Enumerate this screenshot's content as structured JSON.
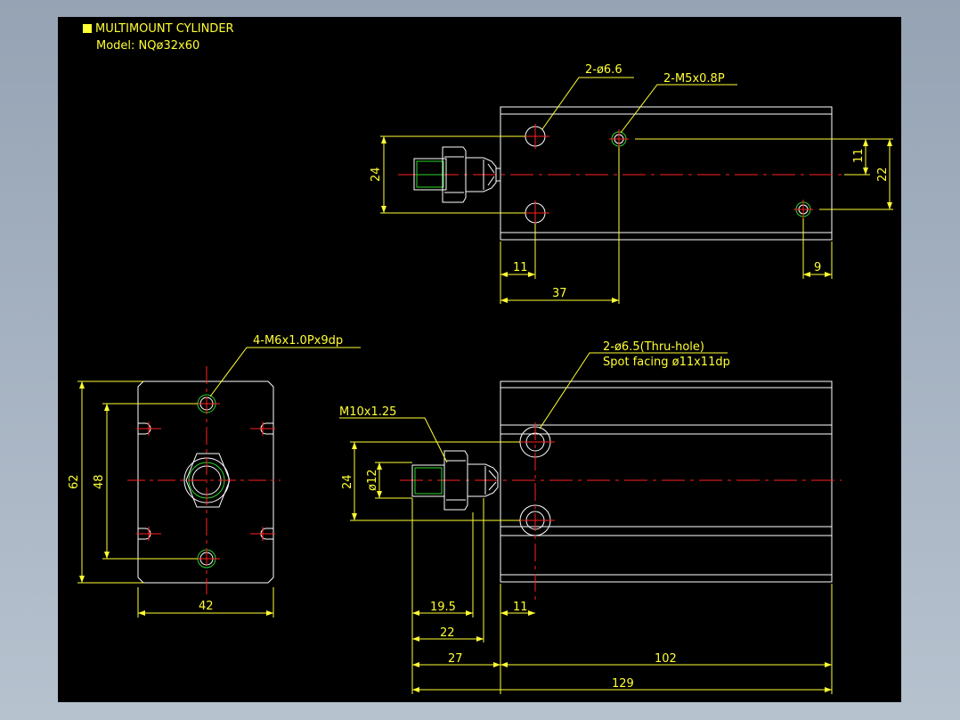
{
  "title": {
    "line1": "MULTIMOUNT CYLINDER",
    "line2": "Model: NQø32x60"
  },
  "top_view": {
    "callout_holes": "2-ø6.6",
    "callout_ports": "2-M5x0.8P",
    "dim_height": "24",
    "dim_11_right": "11",
    "dim_22_right": "22",
    "dim_11_bottom": "11",
    "dim_9_bottom": "9",
    "dim_37_bottom": "37"
  },
  "end_view": {
    "callout_threads": "4-M6x1.0Px9dp",
    "dim_62": "62",
    "dim_48": "48",
    "dim_42": "42"
  },
  "side_view": {
    "callout_thru_line1": "2-ø6.5(Thru-hole)",
    "callout_thru_line2": "Spot facing ø11x11dp",
    "callout_rod_thread": "M10x1.25",
    "dim_24": "24",
    "dim_rod_dia": "ø12",
    "dim_19_5": "19.5",
    "dim_22": "22",
    "dim_27": "27",
    "dim_11": "11",
    "dim_102": "102",
    "dim_129": "129"
  },
  "colors": {
    "background": "#000000",
    "dimension": "#ffff33",
    "outline": "#ffffff",
    "centerline": "#ff2020",
    "detail": "#2bd62b"
  }
}
